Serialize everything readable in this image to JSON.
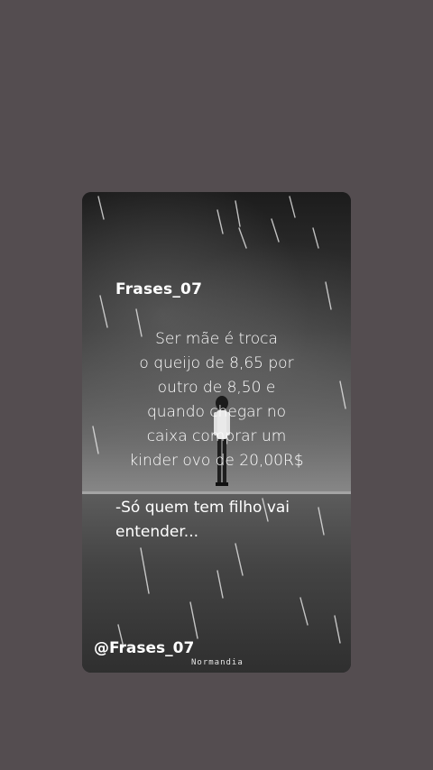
{
  "post": {
    "brand": "Frases_07",
    "quote_lines": [
      "Ser mãe é troca",
      "o queijo de 8,65 por",
      "outro de 8,50 e",
      "quando chegar no",
      "caixa comprar um",
      "kinder ovo de 20,00R$"
    ],
    "tail_lines": [
      "-Só quem tem filho vai",
      "entender..."
    ],
    "handle": "@Frases_07",
    "watermark": "Normandia"
  },
  "colors": {
    "background": "#544d50",
    "text": "#ffffff"
  }
}
